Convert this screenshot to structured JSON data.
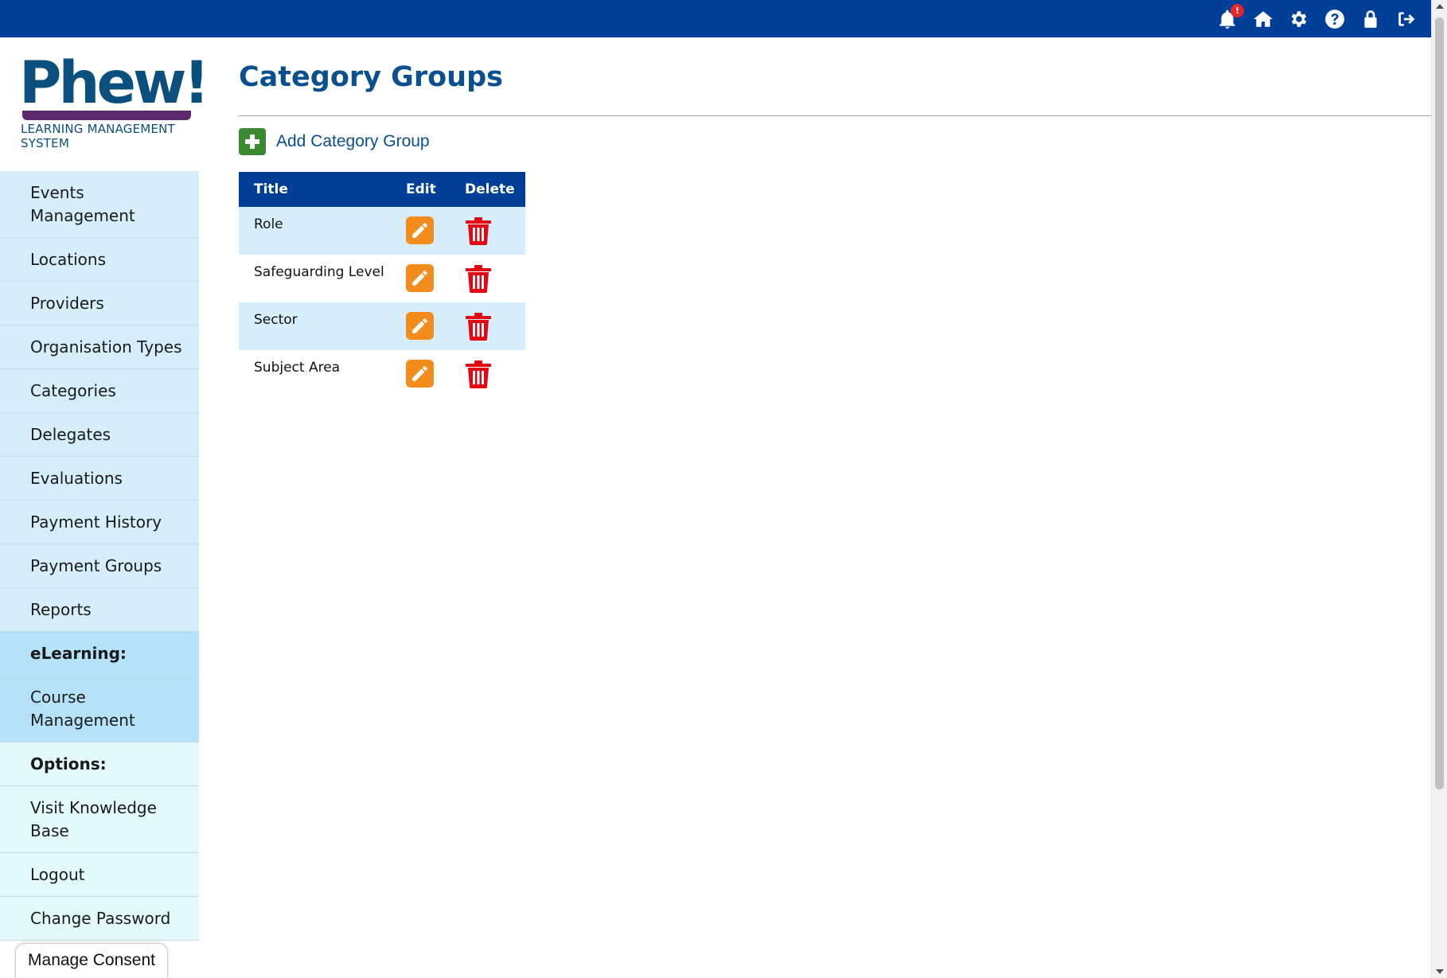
{
  "header": {
    "notification_badge": "!",
    "icons": [
      "bell-icon",
      "home-icon",
      "gear-icon",
      "help-icon",
      "lock-icon",
      "logout-icon"
    ]
  },
  "brand": {
    "logo_word": "Phew!",
    "logo_sub": "LEARNING MANAGEMENT SYSTEM"
  },
  "sidebar": {
    "items": [
      {
        "label": "Events Management"
      },
      {
        "label": "Locations"
      },
      {
        "label": "Providers"
      },
      {
        "label": "Organisation Types"
      },
      {
        "label": "Categories"
      },
      {
        "label": "Delegates"
      },
      {
        "label": "Evaluations"
      },
      {
        "label": "Payment History"
      },
      {
        "label": "Payment Groups"
      },
      {
        "label": "Reports"
      }
    ],
    "elearning_heading": "eLearning:",
    "elearning_items": [
      {
        "label": "Course Management"
      }
    ],
    "options_heading": "Options:",
    "options_items": [
      {
        "label": "Visit Knowledge Base"
      },
      {
        "label": "Logout"
      },
      {
        "label": "Change Password"
      }
    ]
  },
  "main": {
    "title": "Category Groups",
    "add_label": "Add Category Group",
    "table": {
      "columns": [
        "Title",
        "Edit",
        "Delete"
      ],
      "rows": [
        {
          "title": "Role"
        },
        {
          "title": "Safeguarding Level"
        },
        {
          "title": "Sector"
        },
        {
          "title": "Subject Area"
        }
      ]
    }
  },
  "consent": {
    "label": "Manage Consent"
  },
  "colors": {
    "topbar": "#003f98",
    "title": "#0a4f8f",
    "nav_blue": "#d6edfb",
    "nav_elearning": "#b5e2f8",
    "nav_options": "#e2fafb",
    "edit": "#f28c1c",
    "delete": "#e30613",
    "add": "#3b8a32"
  }
}
